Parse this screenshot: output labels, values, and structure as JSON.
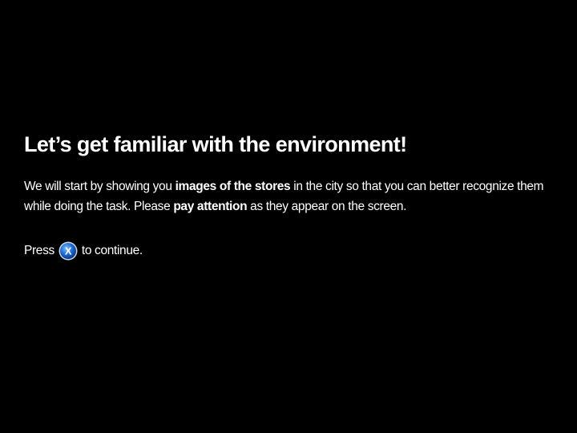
{
  "title": "Let’s get familiar with the environment!",
  "instructions": {
    "part1": "We will start by showing you ",
    "bold1": "images of the stores",
    "part2": " in the city so that you can better recognize them while doing the task. Please ",
    "bold2": "pay attention",
    "part3": " as they appear on the screen."
  },
  "press": {
    "before": "Press",
    "button_icon": "x-button-icon",
    "button_glyph": "X",
    "after": "to continue."
  },
  "colors": {
    "background": "#000000",
    "text": "#ffffff",
    "button_blue": "#1f6fd6"
  }
}
